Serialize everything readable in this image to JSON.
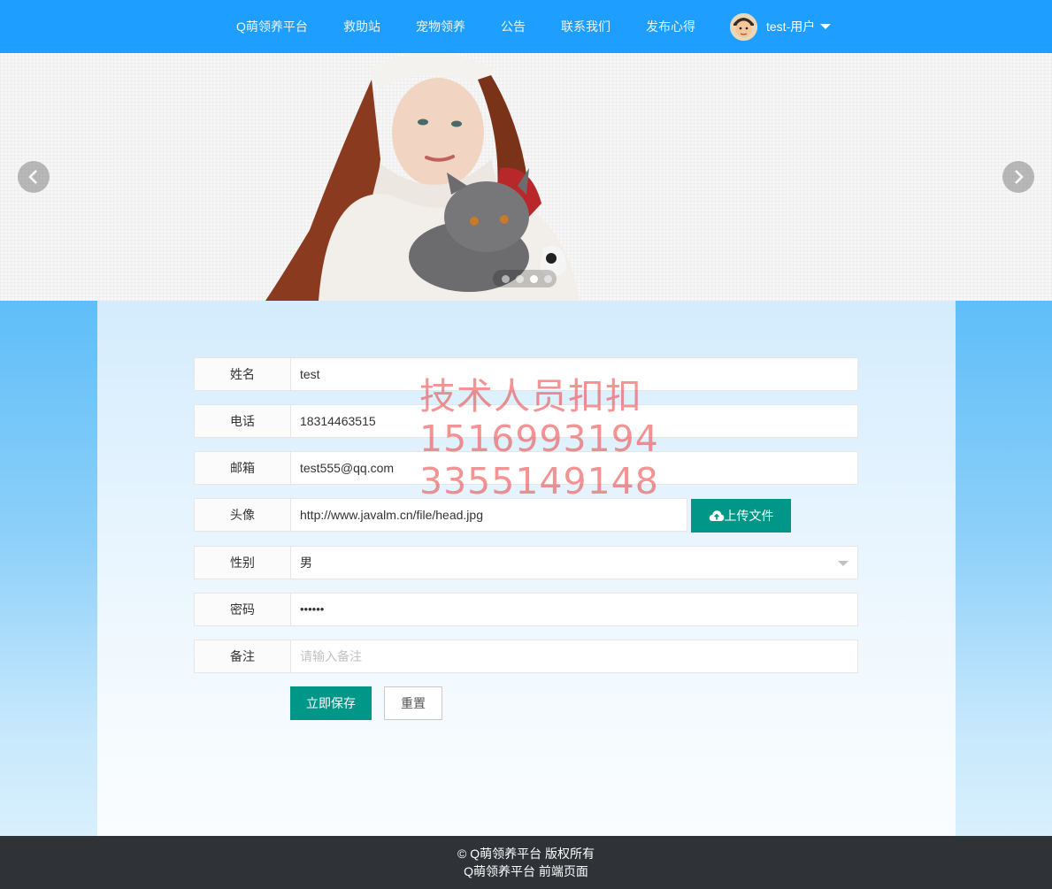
{
  "nav": {
    "items": [
      "Q萌领养平台",
      "救助站",
      "宠物领养",
      "公告",
      "联系我们",
      "发布心得"
    ],
    "user_label": "test-用户",
    "accent_color": "#1e9fff"
  },
  "banner": {
    "prev_icon": "chevron-left-icon",
    "next_icon": "chevron-right-icon",
    "slide_count": 4,
    "active_slide": 3
  },
  "form": {
    "name": {
      "label": "姓名",
      "value": "test"
    },
    "phone": {
      "label": "电话",
      "value": "18314463515"
    },
    "email": {
      "label": "邮箱",
      "value": "test555@qq.com"
    },
    "avatar": {
      "label": "头像",
      "value": "http://www.javalm.cn/file/head.jpg",
      "upload_label": "上传文件",
      "upload_icon": "cloud-upload-icon"
    },
    "gender": {
      "label": "性别",
      "value": "男"
    },
    "password": {
      "label": "密码",
      "value": "••••••"
    },
    "remark": {
      "label": "备注",
      "placeholder": "请输入备注"
    },
    "save_label": "立即保存",
    "reset_label": "重置",
    "button_color": "#009688"
  },
  "watermark": {
    "lines": [
      "技术人员扣扣",
      "1516993194",
      "3355149148"
    ]
  },
  "footer": {
    "line1": "© Q萌领养平台 版权所有",
    "line2": "Q萌领养平台 前端页面"
  }
}
